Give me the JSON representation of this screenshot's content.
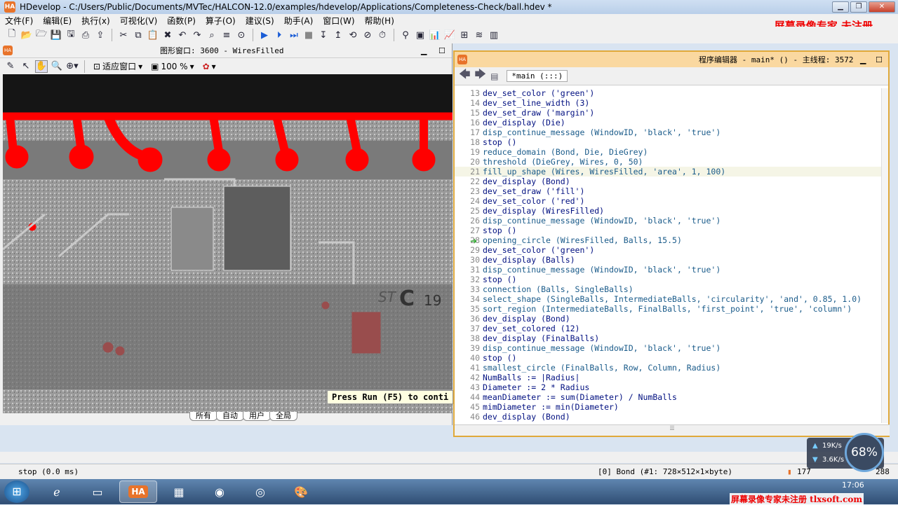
{
  "window": {
    "title": "HDevelop - C:/Users/Public/Documents/MVTec/HALCON-12.0/examples/hdevelop/Applications/Completeness-Check/ball.hdev *"
  },
  "menu": [
    "文件(F)",
    "编辑(E)",
    "执行(x)",
    "可视化(V)",
    "函数(P)",
    "算子(O)",
    "建议(S)",
    "助手(A)",
    "窗口(W)",
    "帮助(H)"
  ],
  "watermark_top": "屏幕录像专家  未注册",
  "graphics_window": {
    "title": "图形窗口: 3600 - WiresFilled",
    "fit_label": "适应窗口",
    "zoom_value": "100 %",
    "overlay_message": "Press Run (F5) to conti",
    "tabs": [
      "所有",
      "自动",
      "用户",
      "全局"
    ]
  },
  "program_editor": {
    "title": "程序编辑器 - main* () - 主线程: 3572",
    "procedure": "*main (:::)",
    "lines": [
      {
        "n": "13",
        "code": "dev_set_color ('green')"
      },
      {
        "n": "14",
        "code": "dev_set_line_width (3)"
      },
      {
        "n": "15",
        "code": "dev_set_draw ('margin')"
      },
      {
        "n": "16",
        "code": "dev_display (Die)"
      },
      {
        "n": "17",
        "code": "disp_continue_message (WindowID, 'black', 'true')"
      },
      {
        "n": "18",
        "code": "stop ()"
      },
      {
        "n": "19",
        "code": "reduce_domain (Bond, Die, DieGrey)"
      },
      {
        "n": "20",
        "code": "threshold (DieGrey, Wires, 0, 50)"
      },
      {
        "n": "21",
        "code": "fill_up_shape (Wires, WiresFilled, 'area', 1, 100)"
      },
      {
        "n": "22",
        "code": "dev_display (Bond)"
      },
      {
        "n": "23",
        "code": "dev_set_draw ('fill')"
      },
      {
        "n": "24",
        "code": "dev_set_color ('red')"
      },
      {
        "n": "25",
        "code": "dev_display (WiresFilled)"
      },
      {
        "n": "26",
        "code": "disp_continue_message (WindowID, 'black', 'true')"
      },
      {
        "n": "27",
        "code": "stop ()"
      },
      {
        "n": "28",
        "code": "opening_circle (WiresFilled, Balls, 15.5)"
      },
      {
        "n": "29",
        "code": "dev_set_color ('green')"
      },
      {
        "n": "30",
        "code": "dev_display (Balls)"
      },
      {
        "n": "31",
        "code": "disp_continue_message (WindowID, 'black', 'true')"
      },
      {
        "n": "32",
        "code": "stop ()"
      },
      {
        "n": "33",
        "code": "connection (Balls, SingleBalls)"
      },
      {
        "n": "34",
        "code": "select_shape (SingleBalls, IntermediateBalls, 'circularity', 'and', 0.85, 1.0)"
      },
      {
        "n": "35",
        "code": "sort_region (IntermediateBalls, FinalBalls, 'first_point', 'true', 'column')"
      },
      {
        "n": "36",
        "code": "dev_display (Bond)"
      },
      {
        "n": "37",
        "code": "dev_set_colored (12)"
      },
      {
        "n": "38",
        "code": "dev_display (FinalBalls)"
      },
      {
        "n": "39",
        "code": "disp_continue_message (WindowID, 'black', 'true')"
      },
      {
        "n": "40",
        "code": "stop ()"
      },
      {
        "n": "41",
        "code": "smallest_circle (FinalBalls, Row, Column, Radius)"
      },
      {
        "n": "42",
        "code": "NumBalls := |Radius|"
      },
      {
        "n": "43",
        "code": "Diameter := 2 * Radius"
      },
      {
        "n": "44",
        "code": "meanDiameter := sum(Diameter) / NumBalls"
      },
      {
        "n": "45",
        "code": "mimDiameter := min(Diameter)"
      },
      {
        "n": "46",
        "code": "dev_display (Bond)"
      }
    ]
  },
  "status": {
    "message": "stop (0.0 ms)",
    "image_info": "[0] Bond (#1: 728×512×1×byte)",
    "value": "177",
    "coords": "288"
  },
  "network": {
    "up": "19K/s",
    "down": "3.6K/s",
    "percent": "68%"
  },
  "clock": "17:06",
  "watermark_bottom": "屏幕录像专家未注册  tlxsoft.com"
}
